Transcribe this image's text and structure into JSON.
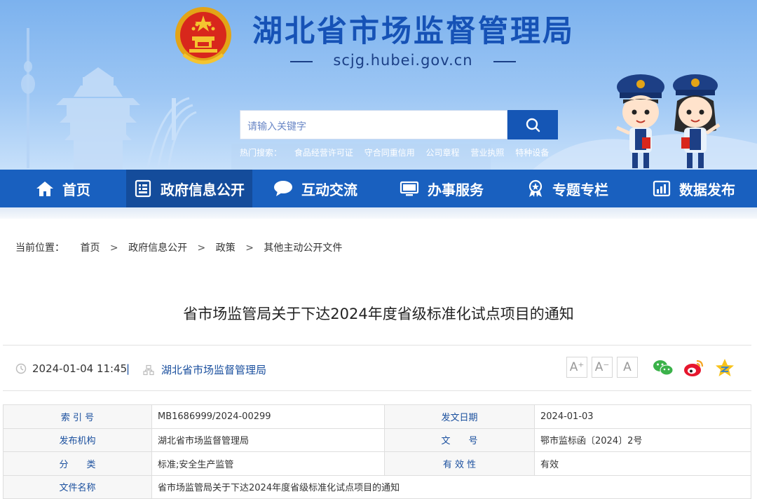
{
  "header": {
    "site_title": "湖北省市场监督管理局",
    "site_domain": "scjg.hubei.gov.cn"
  },
  "search": {
    "placeholder": "请输入关键字",
    "hot_label": "热门搜索：",
    "hot_terms": [
      "食品经营许可证",
      "守合同重信用",
      "公司章程",
      "营业执照",
      "特种设备"
    ]
  },
  "nav": {
    "items": [
      {
        "label": "首页",
        "icon": "home-icon"
      },
      {
        "label": "政府信息公开",
        "icon": "document-list-icon"
      },
      {
        "label": "互动交流",
        "icon": "chat-bubble-icon"
      },
      {
        "label": "办事服务",
        "icon": "monitor-icon"
      },
      {
        "label": "专题专栏",
        "icon": "medal-icon"
      },
      {
        "label": "数据发布",
        "icon": "bar-chart-icon"
      }
    ],
    "active_index": 1
  },
  "breadcrumb": {
    "label": "当前位置：",
    "items": [
      "首页",
      "政府信息公开",
      "政策",
      "其他主动公开文件"
    ],
    "separator": ">"
  },
  "article": {
    "title": "省市场监管局关于下达2024年度省级标准化试点项目的通知",
    "datetime": "2024-01-04 11:45",
    "divider": "|",
    "publisher": "湖北省市场监督管理局"
  },
  "font_controls": [
    "A⁺",
    "A⁻",
    "A"
  ],
  "info_table": {
    "rows": [
      {
        "k1": "索 引 号",
        "v1": "MB1686999/2024-00299",
        "k2": "发文日期",
        "v2": "2024-01-03"
      },
      {
        "k1": "发布机构",
        "v1": "湖北省市场监督管理局",
        "k2": "文　　号",
        "v2": "鄂市监标函〔2024〕2号"
      },
      {
        "k1": "分　　类",
        "v1": "标准;安全生产监管",
        "k2": "有 效 性",
        "v2": "有效"
      },
      {
        "k1": "文件名称",
        "v1": "省市场监管局关于下达2024年度省级标准化试点项目的通知",
        "k2": "",
        "v2": ""
      }
    ]
  },
  "colors": {
    "brand_blue": "#1960bf",
    "nav_active": "#144c9b",
    "title_blue": "#1652b6",
    "link_blue": "#1a4f9e"
  }
}
